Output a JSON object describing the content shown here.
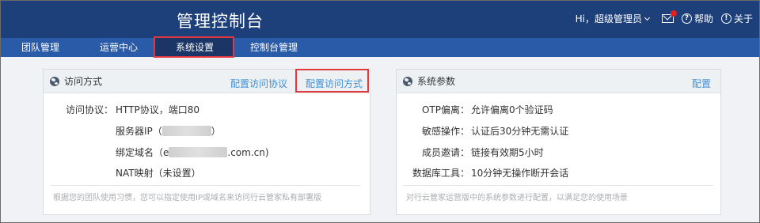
{
  "header": {
    "title": "管理控制台",
    "greeting": "Hi，超级管理员",
    "links": [
      {
        "icon": "question-icon",
        "label": "帮助",
        "glyph": "?"
      },
      {
        "icon": "info-icon",
        "label": "关于",
        "glyph": "!"
      }
    ]
  },
  "nav": {
    "items": [
      "团队管理",
      "运营中心",
      "系统设置",
      "控制台管理"
    ],
    "active": "系统设置"
  },
  "access_card": {
    "title": "访问方式",
    "links": [
      "配置访问协议",
      "配置访问方式"
    ],
    "rows": [
      {
        "label": "访问协议：",
        "value": "HTTP协议，端口80"
      },
      {
        "label": "",
        "prefix": "服务器IP（",
        "suffix": "）"
      },
      {
        "label": "",
        "prefix": "绑定域名（e",
        "suffix": ".com.cn)"
      },
      {
        "label": "",
        "value": "NAT映射（未设置）"
      }
    ],
    "footnote": "根据您的团队使用习惯，您可以指定使用IP或域名来访问行云管家私有部署版"
  },
  "params_card": {
    "title": "系统参数",
    "link": "配置",
    "rows": [
      {
        "label": "OTP偏离：",
        "value": "允许偏离0个验证码"
      },
      {
        "label": "敏感操作：",
        "value": "认证后30分钟无需认证"
      },
      {
        "label": "成员邀请：",
        "value": "链接有效期5小时"
      },
      {
        "label": "数据库工具：",
        "value": "10分钟无操作断开会话"
      }
    ],
    "footnote": "对行云管家运营版中的系统参数进行配置，以满足您的使用场景"
  },
  "colors": {
    "header_bg": "#1d3f7a",
    "nav_bg": "#2a5ba8",
    "nav_active_bg": "#1a3566",
    "link": "#3d8fd6",
    "highlight": "#e0383e"
  }
}
